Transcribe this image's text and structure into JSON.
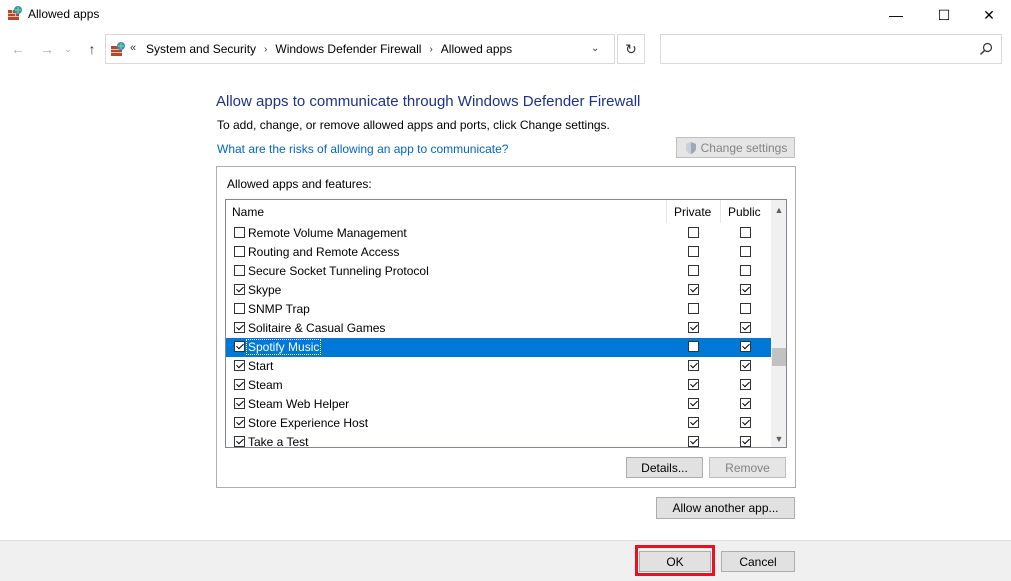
{
  "window": {
    "title": "Allowed apps",
    "minimize_glyph": "—",
    "maximize_glyph": "☐",
    "close_glyph": "✕"
  },
  "nav": {
    "back_glyph": "←",
    "forward_glyph": "→",
    "recent_glyph": "⌄",
    "up_glyph": "↑",
    "refresh_glyph": "↻",
    "chevron_glyph": "«",
    "dropdown_glyph": "⌄"
  },
  "breadcrumb": {
    "items": [
      "System and Security",
      "Windows Defender Firewall",
      "Allowed apps"
    ],
    "separator": "›"
  },
  "search": {
    "placeholder": ""
  },
  "main": {
    "heading": "Allow apps to communicate through Windows Defender Firewall",
    "subtext": "To add, change, or remove allowed apps and ports, click Change settings.",
    "risk_link": "What are the risks of allowing an app to communicate?",
    "change_settings": "Change settings"
  },
  "group": {
    "label": "Allowed apps and features:",
    "columns": {
      "name": "Name",
      "private": "Private",
      "public": "Public"
    },
    "rows": [
      {
        "name": "Remote Volume Management",
        "enabled": false,
        "private": false,
        "public": false,
        "selected": false
      },
      {
        "name": "Routing and Remote Access",
        "enabled": false,
        "private": false,
        "public": false,
        "selected": false
      },
      {
        "name": "Secure Socket Tunneling Protocol",
        "enabled": false,
        "private": false,
        "public": false,
        "selected": false
      },
      {
        "name": "Skype",
        "enabled": true,
        "private": true,
        "public": true,
        "selected": false
      },
      {
        "name": "SNMP Trap",
        "enabled": false,
        "private": false,
        "public": false,
        "selected": false
      },
      {
        "name": "Solitaire & Casual Games",
        "enabled": true,
        "private": true,
        "public": true,
        "selected": false
      },
      {
        "name": "Spotify Music",
        "enabled": true,
        "private": false,
        "public": true,
        "selected": true
      },
      {
        "name": "Start",
        "enabled": true,
        "private": true,
        "public": true,
        "selected": false
      },
      {
        "name": "Steam",
        "enabled": true,
        "private": true,
        "public": true,
        "selected": false
      },
      {
        "name": "Steam Web Helper",
        "enabled": true,
        "private": true,
        "public": true,
        "selected": false
      },
      {
        "name": "Store Experience Host",
        "enabled": true,
        "private": true,
        "public": true,
        "selected": false
      },
      {
        "name": "Take a Test",
        "enabled": true,
        "private": true,
        "public": true,
        "selected": false
      }
    ],
    "details": "Details...",
    "remove": "Remove"
  },
  "allow_another": "Allow another app...",
  "footer": {
    "ok": "OK",
    "cancel": "Cancel"
  },
  "colors": {
    "heading": "#1e3287",
    "link": "#0066cc",
    "selection": "#0078d7",
    "highlight_box": "#e81123"
  }
}
